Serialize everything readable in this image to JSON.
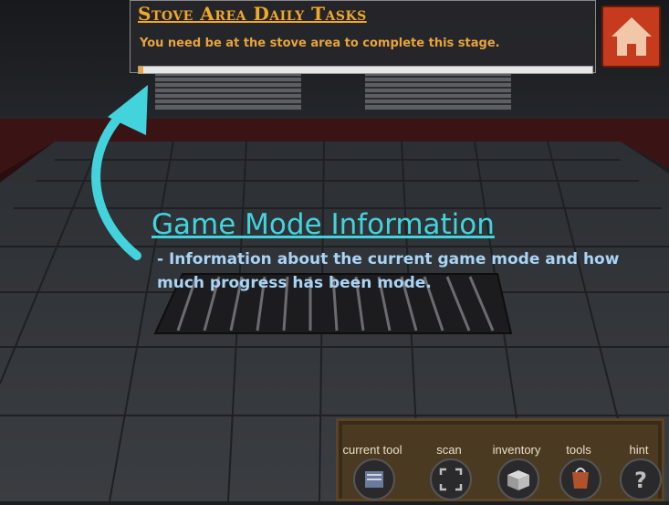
{
  "task": {
    "title": "Stove Area Daily Tasks",
    "description": "You need be at the stove area to complete this stage.",
    "progress": 0.01
  },
  "annotation": {
    "title": "Game Mode Information",
    "description": "- Information about the current game mode and how much progress has been mode.",
    "arrow_color": "#43d3dc"
  },
  "home_button": {
    "icon": "home-icon",
    "color": "#c63a1e"
  },
  "toolbar": {
    "tools": [
      {
        "label": "current tool",
        "icon": "current-tool-icon"
      },
      {
        "label": "scan",
        "icon": "scan-icon"
      },
      {
        "label": "inventory",
        "icon": "inventory-icon"
      },
      {
        "label": "tools",
        "icon": "tools-icon"
      },
      {
        "label": "hint",
        "icon": "hint-icon"
      }
    ]
  }
}
